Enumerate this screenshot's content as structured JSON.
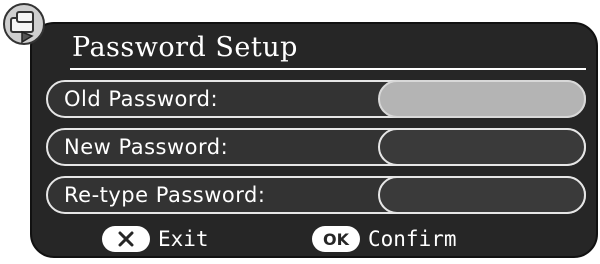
{
  "dialog": {
    "title": "Password Setup",
    "fields": [
      {
        "label": "Old Password:",
        "active": true
      },
      {
        "label": "New Password:",
        "active": false
      },
      {
        "label": "Re-type Password:",
        "active": false
      }
    ]
  },
  "footer": {
    "exit": {
      "icon": "x-pill-icon",
      "label": "Exit"
    },
    "confirm": {
      "icon": "ok-pill-icon",
      "icon_text": "OK",
      "label": "Confirm"
    }
  },
  "colors": {
    "panel": "#262626",
    "border": "#e6e6e6",
    "active_field": "#b4b4b4"
  },
  "corner_icon": "settings-badge-icon"
}
